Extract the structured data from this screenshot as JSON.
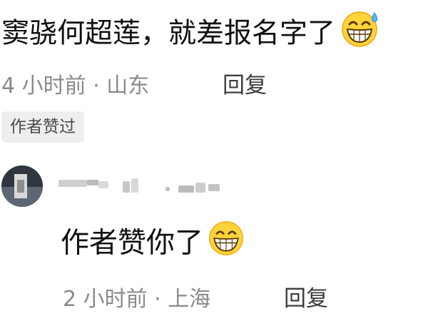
{
  "comment": {
    "text": "窦骁何超莲，就差报名字了",
    "emoji": "grinning-sweat-emoji",
    "time": "4 小时前 · 山东",
    "reply_label": "回复",
    "author_badge": "作者赞过"
  },
  "reply": {
    "text": "作者赞你了",
    "emoji": "grinning-emoji",
    "time": "2 小时前 · 上海",
    "reply_label": "回复"
  },
  "colors": {
    "meta_gray": "#8a8a8a",
    "badge_bg": "#eeeeee",
    "emoji_yellow": "#ffd43b",
    "emoji_outline": "#f0a800"
  }
}
